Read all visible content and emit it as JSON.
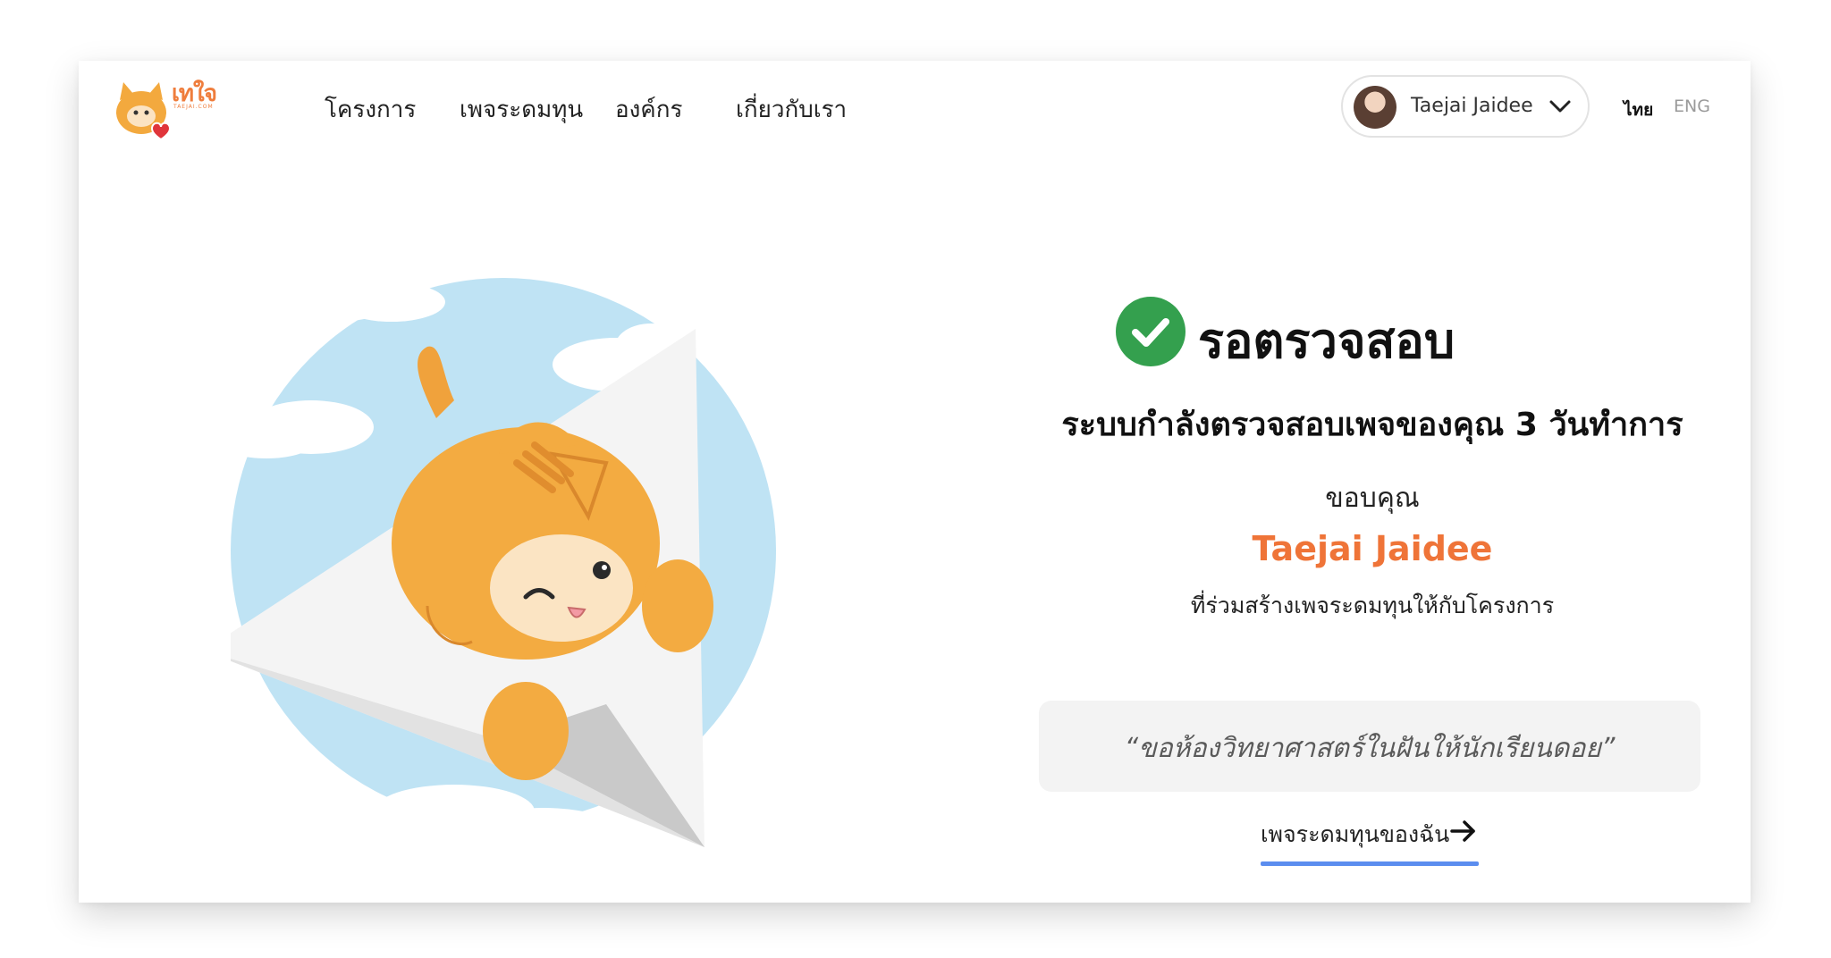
{
  "brand": {
    "logo_text": "เทใจ",
    "logo_sub": "TAEJAI.COM",
    "accent_color": "#ef7438",
    "success_color": "#34a04e",
    "link_underline_color": "#5b8def"
  },
  "nav": {
    "items": [
      {
        "label": "โครงการ"
      },
      {
        "label": "เพจระดมทุน"
      },
      {
        "label": "องค์กร"
      },
      {
        "label": "เกี่ยวกับเรา"
      }
    ]
  },
  "user_menu": {
    "name": "Taejai Jaidee",
    "avatar_icon": "user-avatar",
    "dropdown_icon": "chevron-down-icon"
  },
  "language": {
    "thai_label": "ไทย",
    "english_label": "ENG",
    "active": "ไทย"
  },
  "status": {
    "icon": "check-circle-icon",
    "title": "รอตรวจสอบ",
    "subtitle": "ระบบกำลังตรวจสอบเพจของคุณ 3 วันทำการ",
    "thanks_label": "ขอบคุณ",
    "name": "Taejai Jaidee",
    "contribution_text": "ที่ร่วมสร้างเพจระดมทุนให้กับโครงการ",
    "quote": "“ขอห้องวิทยาศาสตร์ในฝันให้นักเรียนดอย”"
  },
  "link": {
    "label": "เพจระดมทุนของฉัน",
    "icon": "arrow-right-icon"
  }
}
